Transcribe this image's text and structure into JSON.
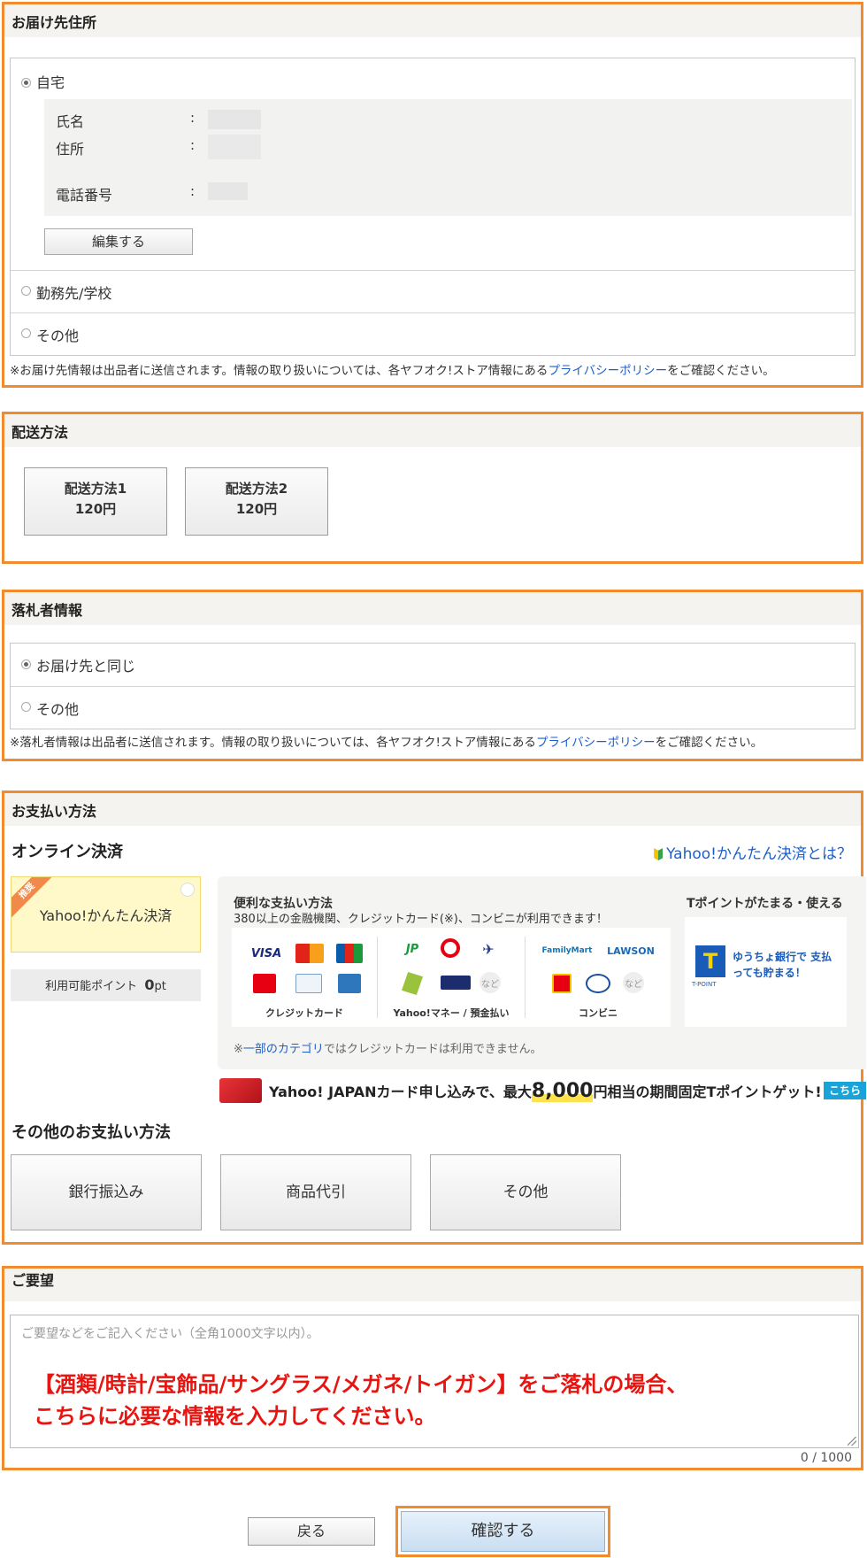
{
  "delivery": {
    "title": "お届け先住所",
    "home_label": "自宅",
    "name_label": "氏名",
    "address_label": "住所",
    "phone_label": "電話番号",
    "colon": ":",
    "edit_button": "編集する",
    "work_label": "勤務先/学校",
    "other_label": "その他",
    "note_prefix": "※お届け先情報は出品者に送信されます。情報の取り扱いについては、各ヤフオク!ストア情報にある",
    "note_link": "プライバシーポリシー",
    "note_suffix": "をご確認ください。"
  },
  "shipping": {
    "title": "配送方法",
    "options": [
      {
        "name": "配送方法1",
        "price": "120円"
      },
      {
        "name": "配送方法2",
        "price": "120円"
      }
    ]
  },
  "bidder": {
    "title": "落札者情報",
    "same_label": "お届け先と同じ",
    "other_label": "その他",
    "note_prefix": "※落札者情報は出品者に送信されます。情報の取り扱いについては、各ヤフオク!ストア情報にある",
    "note_link": "プライバシーポリシー",
    "note_suffix": "をご確認ください。"
  },
  "payment": {
    "title": "お支払い方法",
    "online_title": "オンライン決済",
    "what_is_link": "Yahoo!かんたん決済とは？",
    "recommend_badge": "推奨",
    "easy_pay_label": "Yahoo!かんたん決済",
    "points_label": "利用可能ポイント",
    "points_value": "0",
    "points_unit": "pt",
    "convenient_title": "便利な支払い方法",
    "convenient_sub": "380以上の金融機関、クレジットカード(※)、コンビニが利用できます！",
    "credit_caption": "クレジットカード",
    "money_caption": "Yahoo!マネー / 預金払い",
    "conv_caption": "コンビニ",
    "logos": {
      "visa": "VISA",
      "jp": "JP",
      "familymart": "FamilyMart",
      "lawson": "LAWSON",
      "etc": "など"
    },
    "tpoint_title": "Tポイントがたまる・使える",
    "tpoint_logo": "T-POINT",
    "tpoint_promo": "ゆうちょ銀行で 支払っても貯まる！",
    "credit_note_prefix": "※",
    "credit_note_link": "一部のカテゴリ",
    "credit_note_suffix": "ではクレジットカードは利用できません。",
    "banner_prefix": "Yahoo! JAPANカード申し込みで、最大",
    "banner_amount": "8,000",
    "banner_suffix": "円相当の期間固定Tポイントゲット!",
    "banner_link": "こちら",
    "other_title": "その他のお支払い方法",
    "other_options": [
      "銀行振込み",
      "商品代引",
      "その他"
    ]
  },
  "request": {
    "title": "ご要望",
    "placeholder": "ご要望などをご記入ください（全角1000文字以内）。",
    "highlight_line1": "【酒類/時計/宝飾品/サングラス/メガネ/トイガン】をご落札の場合、",
    "highlight_line2": "こちらに必要な情報を入力してください。",
    "counter": "0 / 1000"
  },
  "footer": {
    "back_button": "戻る",
    "confirm_button": "確認する"
  },
  "colors": {
    "accent_border": "#f28a2e",
    "link": "#1d5fc9",
    "highlight_red": "#e8140f"
  }
}
